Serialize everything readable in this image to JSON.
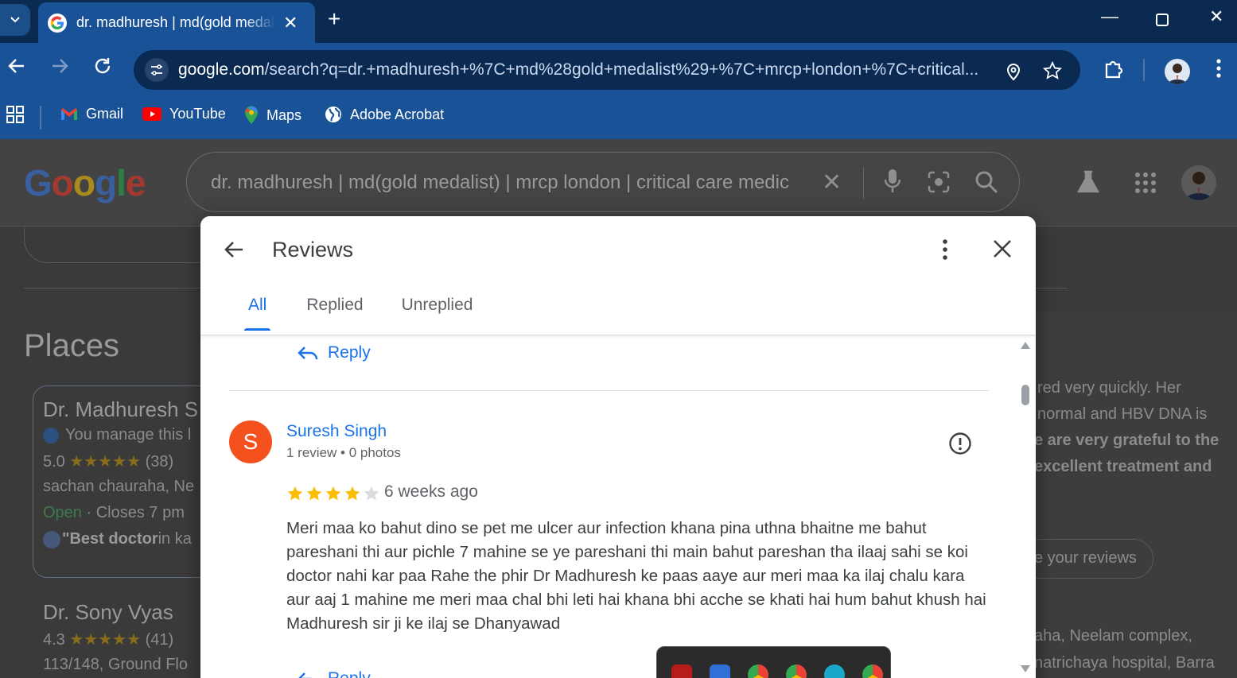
{
  "browser": {
    "tab_title": "dr. madhuresh | md(gold medalist) | mrcp london | critical care medic",
    "url_host": "google.com",
    "url_path": "/search?q=dr.+madhuresh+%7C+md%28gold+medalist%29+%7C+mrcp+london+%7C+critical...",
    "bookmarks": [
      "Gmail",
      "YouTube",
      "Maps",
      "Adobe Acrobat"
    ]
  },
  "page": {
    "search_query": "dr. madhuresh | md(gold medalist) | mrcp london | critical care medic",
    "places_heading": "Places",
    "place1": {
      "name": "Dr. Madhuresh S",
      "manage": "You manage this l",
      "rating": "5.0",
      "count": "(38)",
      "address": "sachan chauraha, Ne",
      "open": "Open",
      "closes": "· Closes 7 pm",
      "quote_bold": "\"Best doctor",
      "quote_rest": " in ka"
    },
    "place2": {
      "name": "Dr. Sony Vyas",
      "rating": "4.3",
      "count": "(41)",
      "address": "113/148, Ground Flo"
    },
    "right_lines": [
      "red very quickly. Her",
      "normal and HBV DNA is",
      "e are very grateful to the",
      "excellent treatment and"
    ],
    "right_button": "e your reviews",
    "right_bottom": [
      "aha, Neelam complex,",
      "natrichaya hospital, Barra"
    ]
  },
  "dialog": {
    "title": "Reviews",
    "tabs": [
      "All",
      "Replied",
      "Unreplied"
    ],
    "reply_label": "Reply",
    "review": {
      "avatar_letter": "S",
      "reviewer": "Suresh Singh",
      "meta": "1 review • 0 photos",
      "stars": 4,
      "date": "6 weeks ago",
      "text": "Meri maa ko bahut dino se pet me ulcer aur infection khana pina uthna bhaitne me bahut pareshani thi aur pichle 7 mahine se ye pareshani thi main bahut pareshan tha ilaaj sahi se koi doctor nahi kar paa Rahe the phir Dr Madhuresh ke paas aaye aur meri maa ka ilaj chalu kara aur aaj 1 mahine me meri maa chal bhi leti hai khana bhi acche se khati hai hum bahut khush hai Madhuresh sir ji ke ilaj se Dhanyawad"
    }
  },
  "colors": {
    "accent": "#1a73e8",
    "chrome_dark": "#0b2a52",
    "chrome": "#1a5298",
    "avatar": "#f4511e",
    "star": "#fbbc04"
  }
}
